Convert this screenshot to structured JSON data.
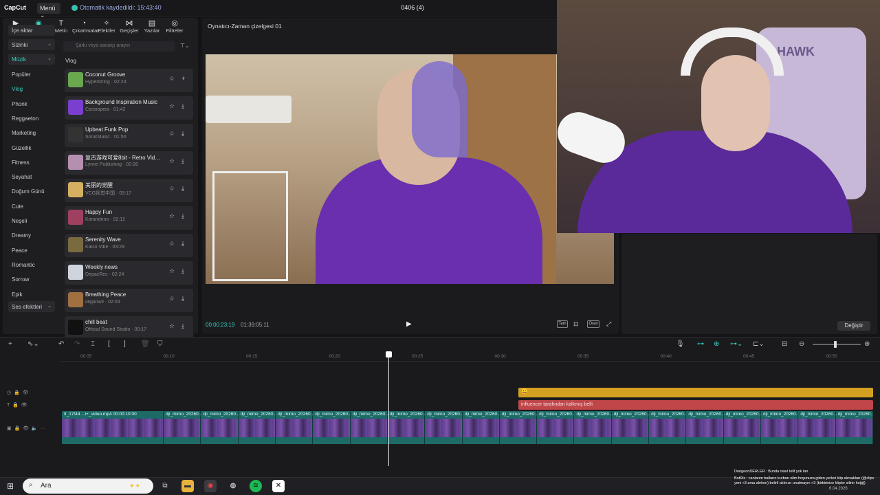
{
  "app": {
    "logo": "CapCut",
    "menu_label": "Menü",
    "autosave": "Otomatik kaydedildi: 15:43:40",
    "project_title": "0406 (4)"
  },
  "toolbar_tabs": [
    {
      "label": "Medya",
      "icon": "media-icon",
      "glyph": "▶"
    },
    {
      "label": "Ses",
      "icon": "audio-icon",
      "glyph": "◉"
    },
    {
      "label": "Metin",
      "icon": "text-icon",
      "glyph": "T"
    },
    {
      "label": "Çıkartmalar",
      "icon": "sticker-icon",
      "glyph": "◔"
    },
    {
      "label": "Efektler",
      "icon": "effects-icon",
      "glyph": "✧"
    },
    {
      "label": "Geçişler",
      "icon": "transitions-icon",
      "glyph": "⋈"
    },
    {
      "label": "Yazılar",
      "icon": "captions-icon",
      "glyph": "▤"
    },
    {
      "label": "Filtreler",
      "icon": "filters-icon",
      "glyph": "◎"
    }
  ],
  "categories": {
    "import": "İçe aktar",
    "yours": "Sizinki",
    "music": "Müzik",
    "items": [
      "Popüler",
      "Vlog",
      "Phonk",
      "Reggaeton",
      "Marketing",
      "Güzellik",
      "Fitness",
      "Seyahat",
      "Doğum Günü",
      "Cute",
      "Neşeli",
      "Dreamy",
      "Peace",
      "Romantic",
      "Sorrow",
      "Epik"
    ],
    "sfx": "Ses efektleri"
  },
  "search": {
    "placeholder": "Şarkı veya sanatçı arayın"
  },
  "list_heading": "Vlog",
  "tracks": [
    {
      "title": "Coconut Groove",
      "meta": "Hyperstring · 02:23",
      "color": "#6aa84f",
      "action": "+"
    },
    {
      "title": "Background Inspiration Music",
      "meta": "Cassiopeia · 01:42",
      "color": "#7b3fd0",
      "action": "⤓"
    },
    {
      "title": "Upbeat Funk Pop",
      "meta": "SonicMusic · 01:50",
      "color": "#333333",
      "action": "⤓"
    },
    {
      "title": "复古游戏可爱8bit - Retro Video ...",
      "meta": "Lynne Publishing · 02:26",
      "color": "#b48fb0",
      "action": "⤓"
    },
    {
      "title": "美丽的觉醒",
      "meta": "VCG视觉中国 · 03:17",
      "color": "#d4b060",
      "action": "⤓"
    },
    {
      "title": "Happy Fun",
      "meta": "Korandrino · 02:12",
      "color": "#a04060",
      "action": "⤓"
    },
    {
      "title": "Serenity Wave",
      "meta": "Kaiso Vibe · 03:29",
      "color": "#7a6a40",
      "action": "⤓"
    },
    {
      "title": "Weekly news",
      "meta": "DepacRec · 02:24",
      "color": "#cfd4dc",
      "action": "⤓"
    },
    {
      "title": "Breathing Peace",
      "meta": "oliganwil · 02:04",
      "color": "#a07040",
      "action": "⤓"
    },
    {
      "title": "chill beat",
      "meta": "Official Sound Studio · 00:17",
      "color": "#111111",
      "action": "⤓"
    }
  ],
  "player": {
    "title": "Oynatıcı-Zaman çizelgesi 01",
    "time_current": "00:00:23:19",
    "time_total": "01:39:05:11",
    "full_label": "Tam",
    "ratio_label": "Oran"
  },
  "right_panel": {
    "change_label": "Değiştir"
  },
  "timeline": {
    "ruler": [
      "00:05",
      "00:10",
      "00:15",
      "00:20",
      "00:25",
      "00:30",
      "00:35",
      "00:40",
      "00:45",
      "00:50"
    ],
    "text_clip": "influencer tarafından kalkmış belli",
    "emoji_clip": "😀",
    "first_clip_label": "II_17/44 ...i+_video.mp4   00:00:10:00",
    "clip_label": "dji_mimo_20260...",
    "clip_count": 20
  },
  "taskbar": {
    "search_label": "Ara"
  },
  "chat": {
    "line1": "DungeonDERLER : Bunda nasıl telif yok lan",
    "line2": "BotRix : canlarım balların kurban olim hoşunuza giden yerleri klip alırsakları (@clips yeni <3 ama alırken) belirli aklınızı unutmayın <3 (birbirinize klipler silinir hoğğ)"
  },
  "tray": {
    "date": "6.04.2026"
  }
}
